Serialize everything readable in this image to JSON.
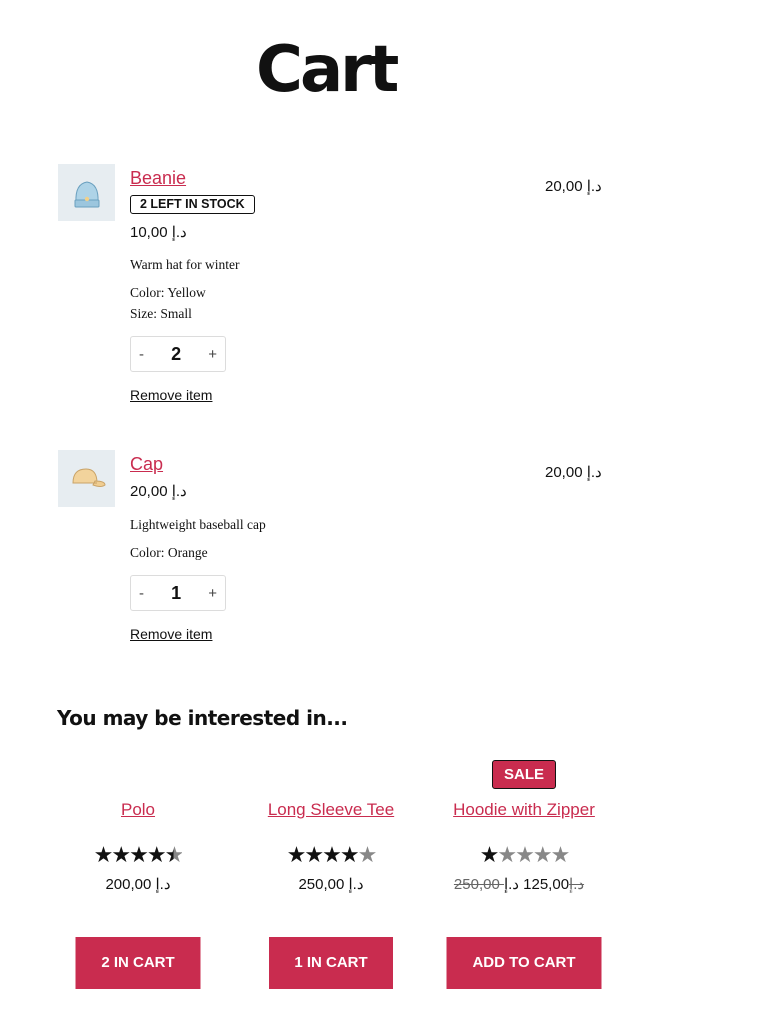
{
  "page": {
    "title": "Cart"
  },
  "cart": {
    "items": [
      {
        "name": "Beanie",
        "stock_badge": "2 LEFT IN STOCK",
        "unit_price": "10,00 د.إ",
        "description": "Warm hat for winter",
        "attributes": [
          "Color: Yellow",
          "Size: Small"
        ],
        "quantity": "2",
        "total": "20,00 د.إ",
        "remove_label": "Remove item",
        "thumb_icon": "beanie-icon"
      },
      {
        "name": "Cap",
        "unit_price": "20,00 د.إ",
        "description": "Lightweight baseball cap",
        "attributes": [
          "Color: Orange"
        ],
        "quantity": "1",
        "total": "20,00 د.إ",
        "remove_label": "Remove item",
        "thumb_icon": "cap-icon"
      }
    ],
    "qty_minus": "-",
    "qty_plus": "+"
  },
  "crosssells": {
    "heading": "You may be interested in...",
    "products": [
      {
        "name": "Polo",
        "rating": 4.5,
        "stars": "★★★★★",
        "price": "200,00 د.إ",
        "button": "2 IN CART"
      },
      {
        "name": "Long Sleeve Tee",
        "rating": 4,
        "stars": "★★★★★",
        "price": "250,00 د.إ",
        "button": "1 IN CART"
      },
      {
        "name": "Hoodie with Zipper",
        "rating": 1,
        "stars": "★★★★★",
        "sale_badge": "SALE",
        "old_price": "250,00 د.إ",
        "price": "125,00 د.إ",
        "button": "ADD TO CART"
      }
    ]
  },
  "colors": {
    "accent": "#c92c4f",
    "star": "#111111",
    "star_empty": "#888888"
  }
}
